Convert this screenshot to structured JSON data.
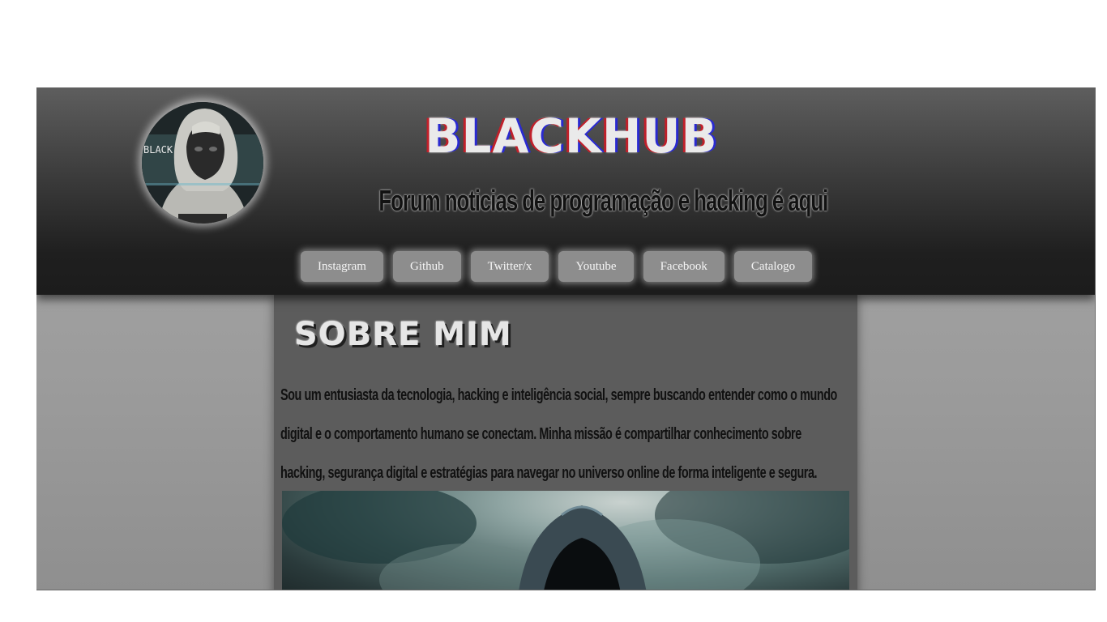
{
  "header": {
    "logo_text": "BLACKHUB",
    "tagline": "Forum noticias de programação e hacking é aqui",
    "avatar_caption": "BLACK"
  },
  "nav": {
    "items": [
      {
        "label": "Instagram"
      },
      {
        "label": "Github"
      },
      {
        "label": "Twitter/x"
      },
      {
        "label": "Youtube"
      },
      {
        "label": "Facebook"
      },
      {
        "label": "Catalogo"
      }
    ]
  },
  "about": {
    "title": "SOBRE MIM",
    "text": "Sou um entusiasta da tecnologia, hacking e inteligência social, sempre buscando entender como o mundo digital e o comportamento humano se conectam. Minha missão é compartilhar conhecimento sobre hacking, segurança digital e estratégias para navegar no universo online de forma inteligente e segura."
  },
  "colors": {
    "header_top": "#5e5e5e",
    "header_bottom": "#1c1c1c",
    "content_bg": "#5c5c5c",
    "nav_button": "#8d8d8d",
    "logo_shadow_red": "#c0202a",
    "logo_shadow_blue": "#2a2ad0"
  }
}
